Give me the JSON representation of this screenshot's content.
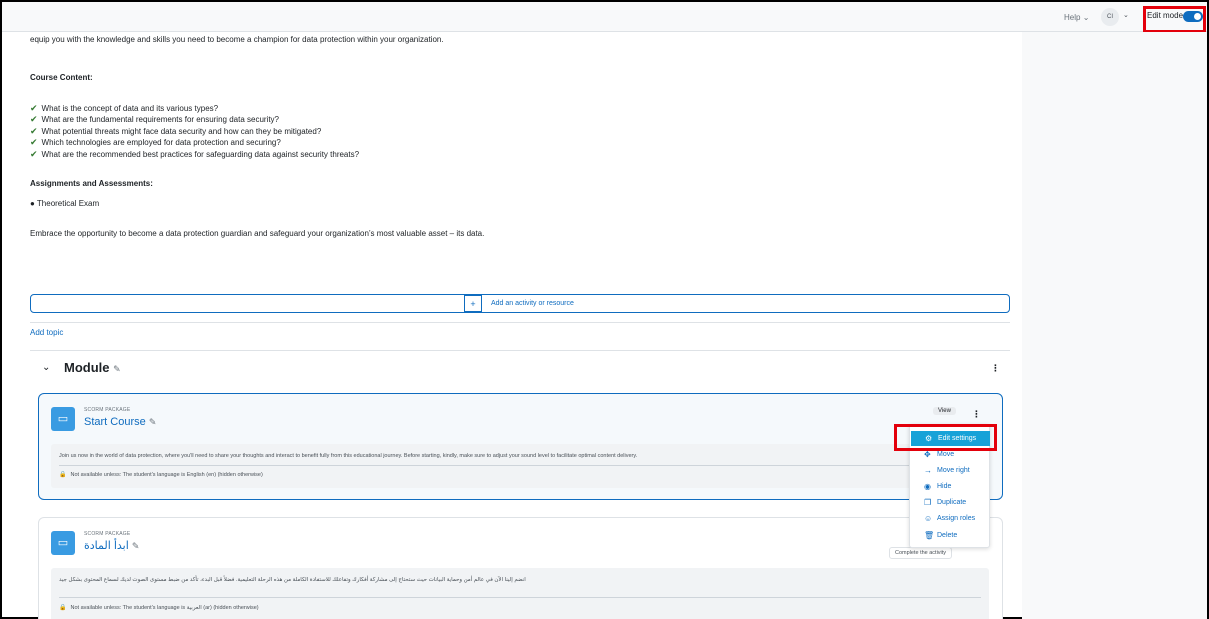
{
  "topbar": {
    "help_label": "Help",
    "help_caret": "⌄",
    "avatar_initials": "CI",
    "avatar_caret": "⌄",
    "edit_mode_label": "Edit mode",
    "edit_mode_on": true
  },
  "intro": {
    "line": "equip you with the knowledge and skills you need to become a champion for data protection within your organization.",
    "content_heading": "Course Content:",
    "checklist": [
      "What is the concept of data and its various types?",
      "What are the fundamental requirements for ensuring data security?",
      "What potential threats might face data security and how can they be mitigated?",
      "Which technologies are employed for data protection and securing?",
      "What are the recommended best practices for safeguarding data against security threats?"
    ],
    "assign_heading": "Assignments and Assessments:",
    "bullet": "● Theoretical Exam",
    "closing": "Embrace the opportunity to become a data protection guardian and safeguard your organization’s most valuable asset – its data."
  },
  "add_activity": {
    "plus": "+",
    "label": "Add an activity or resource"
  },
  "add_topic_label": "Add topic",
  "module": {
    "title": "Module",
    "activities": [
      {
        "type_label": "SCORM PACKAGE",
        "name": "Start Course",
        "description": "Join us now in the world of data protection, where you'll need to share your thoughts and interact to benefit fully from this educational journey. Before starting, kindly, make sure to adjust your sound level to facilitate optimal content delivery.",
        "restriction": "Not available unless: The student's language is English (en) (hidden otherwise)",
        "view_label": "View"
      },
      {
        "type_label": "SCORM PACKAGE",
        "name": "ابدأ المادة",
        "description": "انضم إلينا الآن في عالم أمن وحماية البيانات حيث ستحتاج إلى مشاركة أفكارك وتفاعلك للاستفادة الكاملة من هذه الرحلة التعليمية. فضلاً قبل البدء، تأكد من ضبط مستوى الصوت لديك لسماع المحتوى بشكل جيد",
        "restriction": "Not available unless: The student's language is العربية (ar) (hidden otherwise)",
        "completion_label": "Complete the activity"
      }
    ]
  },
  "action_menu": {
    "items": [
      {
        "label": "Edit settings",
        "icon": "gear-icon"
      },
      {
        "label": "Move",
        "icon": "move-icon"
      },
      {
        "label": "Move right",
        "icon": "arrow-right-icon"
      },
      {
        "label": "Hide",
        "icon": "eye-icon"
      },
      {
        "label": "Duplicate",
        "icon": "duplicate-icon"
      },
      {
        "label": "Assign roles",
        "icon": "user-icon"
      },
      {
        "label": "Delete",
        "icon": "trash-icon"
      }
    ]
  },
  "colors": {
    "accent": "#0f6cbf",
    "highlight": "#e3000b",
    "menu_active": "#17a2d8",
    "scorm_icon": "#399be2",
    "check": "#357a32"
  }
}
